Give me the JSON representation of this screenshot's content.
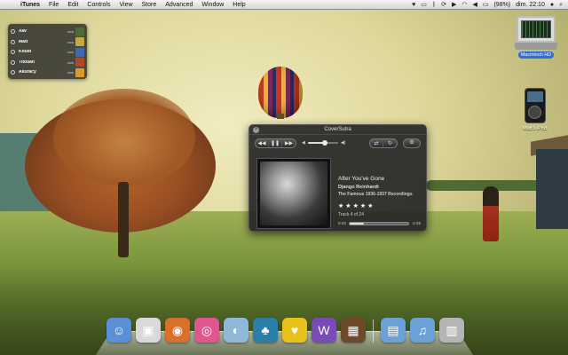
{
  "menubar": {
    "app_name": "iTunes",
    "menus": [
      "File",
      "Edit",
      "Controls",
      "View",
      "Store",
      "Advanced",
      "Window",
      "Help"
    ],
    "battery": "(98%)",
    "clock": "dim. 22:10"
  },
  "now_playing_widget": {
    "items": [
      {
        "title": "Xav",
        "subtitle": "",
        "time": "now",
        "thumb_color": "#4d6a3a"
      },
      {
        "title": "Matt",
        "subtitle": "",
        "time": "now",
        "thumb_color": "#c8a640"
      },
      {
        "title": "Koubi",
        "subtitle": "",
        "time": "now",
        "thumb_color": "#3f6aa8"
      },
      {
        "title": "Titouan",
        "subtitle": "",
        "time": "now",
        "thumb_color": "#b5452a"
      },
      {
        "title": "Akuracy",
        "subtitle": "",
        "time": "now",
        "thumb_color": "#d99b2a"
      }
    ]
  },
  "desktop": {
    "icons": [
      {
        "label": "Macintosh HD",
        "selected": true
      },
      {
        "label": "Matt's iPod",
        "selected": false
      }
    ]
  },
  "coversutra": {
    "title": "CoverSutra",
    "song": "After You've Gone",
    "artist": "Django Reinhardt",
    "album": "The Famous 1936-1937 Recordings",
    "rating": 5,
    "track_text": "Track 4 of 24",
    "elapsed": "0:43",
    "remaining": "-2:26",
    "progress": 0.25,
    "volume": 0.55,
    "glyphs": {
      "star": "★",
      "close": "×",
      "gear": "⚙"
    }
  },
  "dock": {
    "items": [
      {
        "name": "finder",
        "color": "#5b8fd6",
        "glyph": "☺"
      },
      {
        "name": "photos",
        "color": "#d9d9d9",
        "glyph": "▣"
      },
      {
        "name": "burger",
        "color": "#d9702a",
        "glyph": "◉"
      },
      {
        "name": "donut",
        "color": "#e0568f",
        "glyph": "◎"
      },
      {
        "name": "snowglobe",
        "color": "#8fb8d9",
        "glyph": "◐"
      },
      {
        "name": "frog",
        "color": "#2a7fa8",
        "glyph": "♣"
      },
      {
        "name": "duck",
        "color": "#e8c21a",
        "glyph": "♥"
      },
      {
        "name": "purple-w",
        "color": "#7a4ab8",
        "glyph": "W"
      },
      {
        "name": "board",
        "color": "#6e4a2a",
        "glyph": "▦"
      },
      {
        "name": "folder",
        "color": "#6aa2d8",
        "glyph": "▤"
      },
      {
        "name": "music-folder",
        "color": "#6aa2d8",
        "glyph": "♫"
      },
      {
        "name": "trash",
        "color": "#b5b5b5",
        "glyph": "▥"
      }
    ]
  }
}
